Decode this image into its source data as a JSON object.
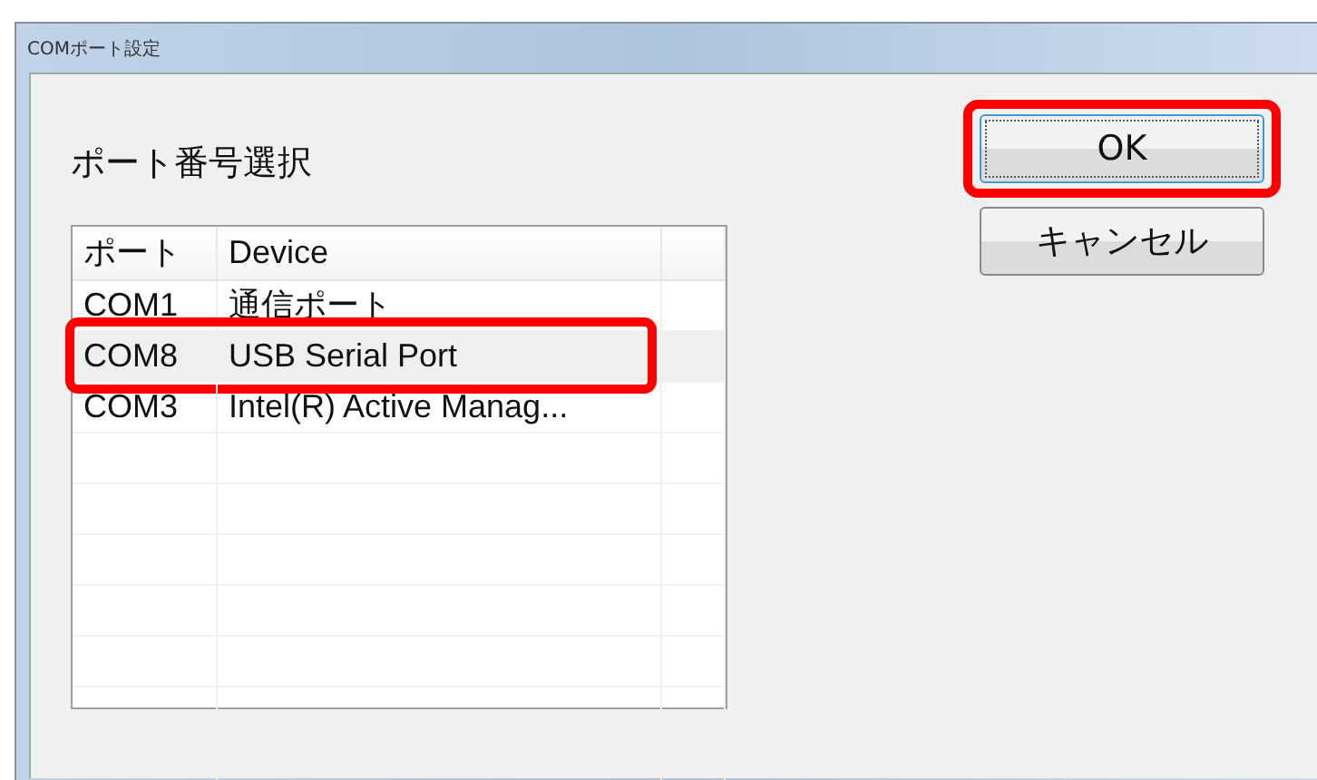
{
  "window": {
    "title": "COMポート設定"
  },
  "heading": "ポート番号選択",
  "list": {
    "columns": [
      "ポート",
      "Device"
    ],
    "rows": [
      {
        "port": "COM1",
        "device": "通信ポート",
        "selected": false,
        "highlighted": false
      },
      {
        "port": "COM8",
        "device": "USB Serial Port",
        "selected": true,
        "highlighted": true
      },
      {
        "port": "COM3",
        "device": "Intel(R) Active Manag...",
        "selected": false,
        "highlighted": false
      }
    ]
  },
  "buttons": [
    {
      "label": "OK",
      "focused": true,
      "highlighted": true
    },
    {
      "label": "キャンセル",
      "focused": false,
      "highlighted": false
    }
  ]
}
